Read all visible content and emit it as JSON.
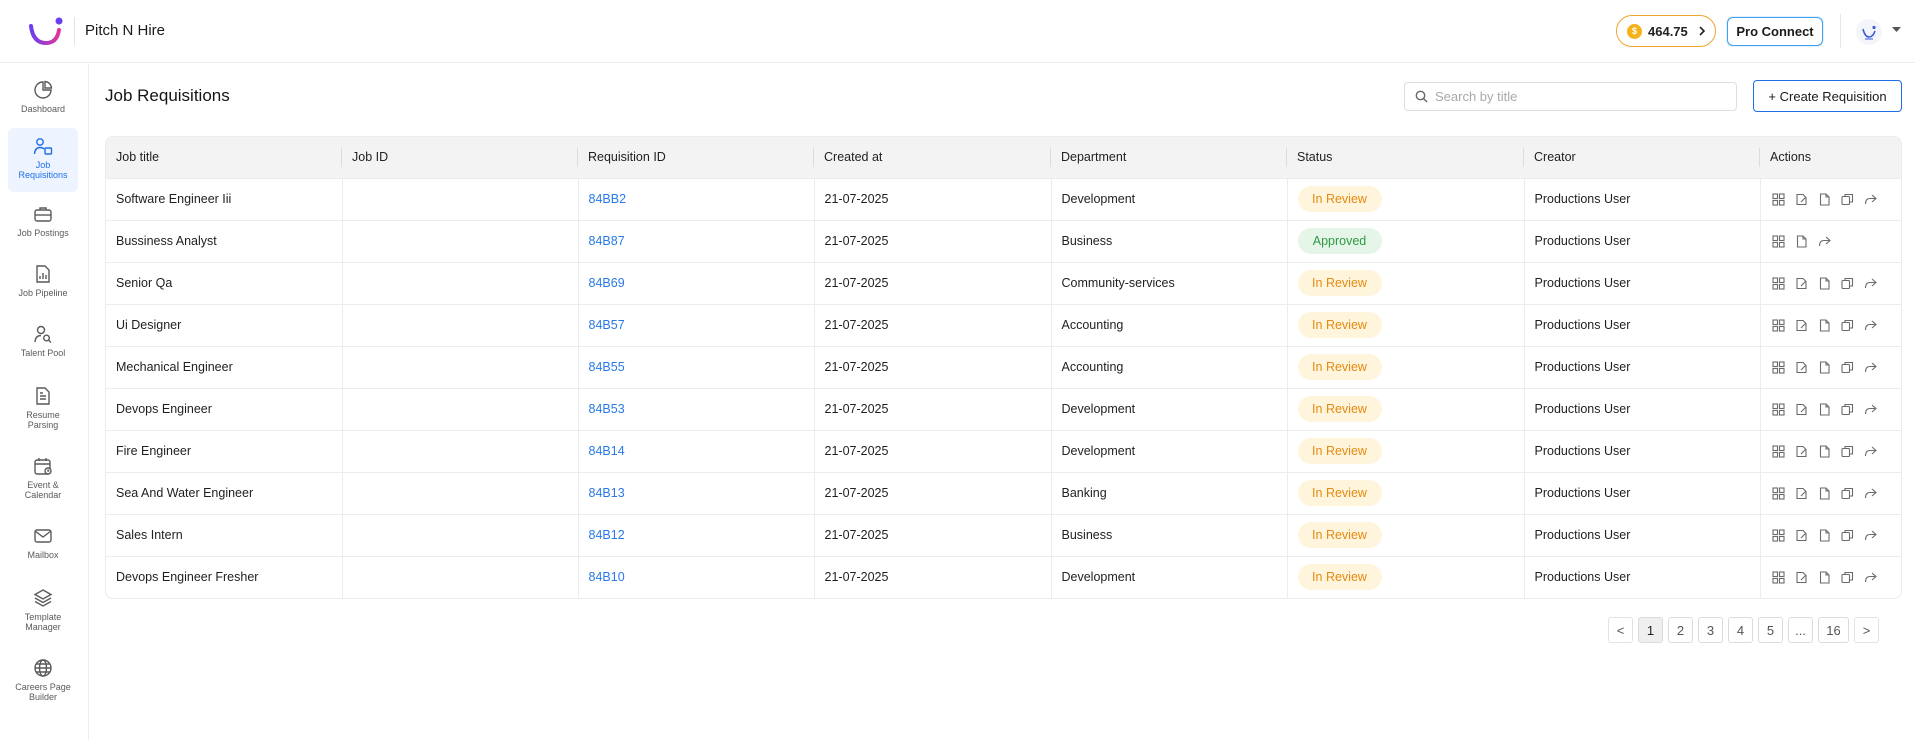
{
  "app": {
    "brand": "Pitch N Hire"
  },
  "topbar": {
    "credits": "464.75",
    "pro_connect": "Pro Connect"
  },
  "sidebar": {
    "items": [
      {
        "label": "Dashboard",
        "icon": "pie-chart-icon",
        "active": false
      },
      {
        "label": "Job\nRequisitions",
        "icon": "user-list-icon",
        "active": true
      },
      {
        "label": "Job Postings",
        "icon": "briefcase-icon",
        "active": false
      },
      {
        "label": "Job Pipeline",
        "icon": "document-chart-icon",
        "active": false
      },
      {
        "label": "Talent Pool",
        "icon": "user-search-icon",
        "active": false
      },
      {
        "label": "Resume\nParsing",
        "icon": "file-text-icon",
        "active": false
      },
      {
        "label": "Event &\nCalendar",
        "icon": "calendar-icon",
        "active": false
      },
      {
        "label": "Mailbox",
        "icon": "mail-icon",
        "active": false
      },
      {
        "label": "Template\nManager",
        "icon": "layers-icon",
        "active": false
      },
      {
        "label": "Careers Page\nBuilder",
        "icon": "globe-icon",
        "active": false
      }
    ]
  },
  "page": {
    "title": "Job Requisitions",
    "search_placeholder": "Search by title",
    "create_label": "+ Create Requisition"
  },
  "table": {
    "columns": [
      "Job title",
      "Job ID",
      "Requisition ID",
      "Created at",
      "Department",
      "Status",
      "Creator",
      "Actions"
    ],
    "rows": [
      {
        "title": "Software Engineer Iii",
        "job_id": "",
        "req_id": "84BB2",
        "created": "21-07-2025",
        "department": "Development",
        "status": "In Review",
        "creator": "Productions User"
      },
      {
        "title": "Bussiness Analyst",
        "job_id": "",
        "req_id": "84B87",
        "created": "21-07-2025",
        "department": "Business",
        "status": "Approved",
        "creator": "Productions User"
      },
      {
        "title": "Senior Qa",
        "job_id": "",
        "req_id": "84B69",
        "created": "21-07-2025",
        "department": "Community-services",
        "status": "In Review",
        "creator": "Productions User"
      },
      {
        "title": "Ui Designer",
        "job_id": "",
        "req_id": "84B57",
        "created": "21-07-2025",
        "department": "Accounting",
        "status": "In Review",
        "creator": "Productions User"
      },
      {
        "title": "Mechanical Engineer",
        "job_id": "",
        "req_id": "84B55",
        "created": "21-07-2025",
        "department": "Accounting",
        "status": "In Review",
        "creator": "Productions User"
      },
      {
        "title": "Devops Engineer",
        "job_id": "",
        "req_id": "84B53",
        "created": "21-07-2025",
        "department": "Development",
        "status": "In Review",
        "creator": "Productions User"
      },
      {
        "title": "Fire Engineer",
        "job_id": "",
        "req_id": "84B14",
        "created": "21-07-2025",
        "department": "Development",
        "status": "In Review",
        "creator": "Productions User"
      },
      {
        "title": "Sea And Water Engineer",
        "job_id": "",
        "req_id": "84B13",
        "created": "21-07-2025",
        "department": "Banking",
        "status": "In Review",
        "creator": "Productions User"
      },
      {
        "title": "Sales Intern",
        "job_id": "",
        "req_id": "84B12",
        "created": "21-07-2025",
        "department": "Business",
        "status": "In Review",
        "creator": "Productions User"
      },
      {
        "title": "Devops Engineer Fresher",
        "job_id": "",
        "req_id": "84B10",
        "created": "21-07-2025",
        "department": "Development",
        "status": "In Review",
        "creator": "Productions User"
      }
    ]
  },
  "pagination": {
    "prev": "<",
    "next": ">",
    "pages": [
      "1",
      "2",
      "3",
      "4",
      "5",
      "...",
      "16"
    ],
    "current": "1"
  },
  "colors": {
    "accent": "#1e6fe8",
    "link": "#2979e6",
    "review_bg": "#fff5dc",
    "review_fg": "#e48a12",
    "approved_bg": "#e5f5e7",
    "approved_fg": "#2f9a45",
    "coin": "#f6b21b"
  }
}
